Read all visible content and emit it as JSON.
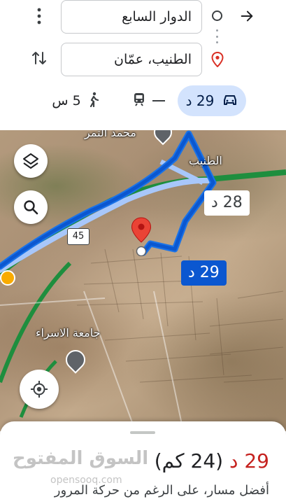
{
  "search": {
    "origin": "الدوار السابع",
    "destination": "الطنيب، عمّان"
  },
  "modes": {
    "drive_label": "29 د",
    "walk_label": "5 س"
  },
  "map": {
    "label_north": "محمد التمر",
    "label_tunaib": "الطنيب",
    "label_university": "جامعة الاسراء",
    "road_shield": "45",
    "callout_alt": "28 د",
    "callout_main": "29 د"
  },
  "sheet": {
    "time": "29 د",
    "distance": "(24 كم)",
    "subtext": "أفضل مسار، على الرغم من حركة المرور"
  },
  "watermark": {
    "brand": "السوق المفتوح",
    "domain": "opensooq.com"
  },
  "colors": {
    "accent": "#0b57d0",
    "drive_chip": "#d3e3fd",
    "time_red": "#c5221f",
    "route_alt": "#a8c7fa",
    "highway_green": "#1e8e3e"
  },
  "icons": {
    "back": "arrow-right-icon",
    "more": "kebab-icon",
    "swap": "swap-vertical-icon",
    "origin": "circle-icon",
    "destination": "pin-icon",
    "drive": "car-icon",
    "transit": "train-icon",
    "walk": "walking-icon",
    "layers": "layers-icon",
    "search": "search-icon",
    "locate": "my-location-icon"
  }
}
